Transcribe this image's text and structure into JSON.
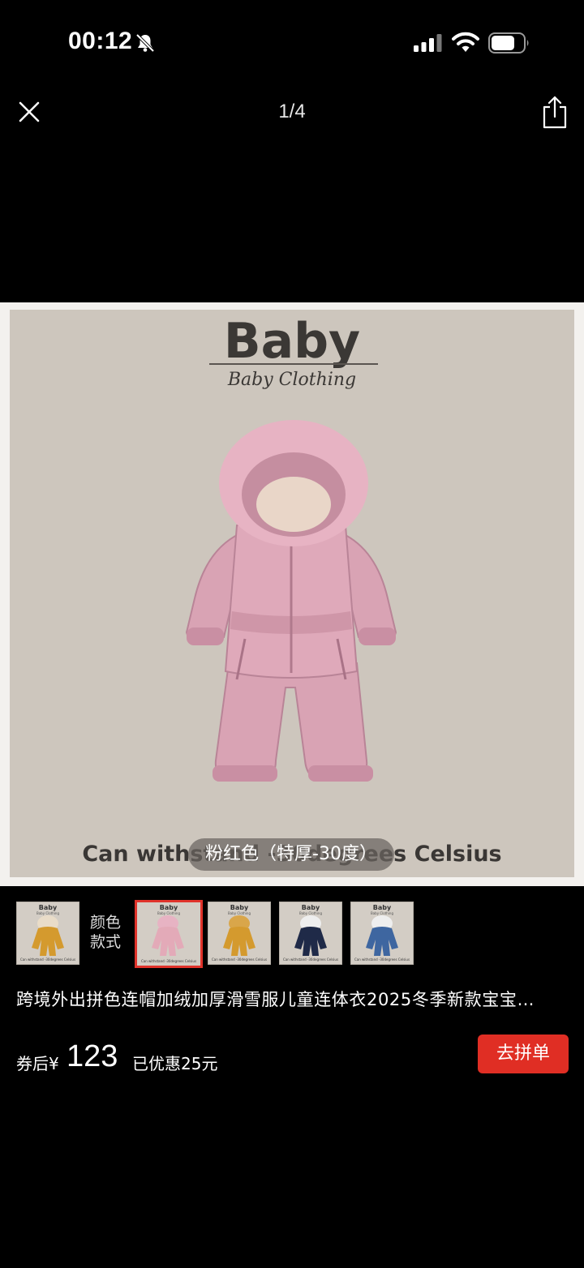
{
  "status_bar": {
    "time": "00:12",
    "icons": [
      "bell-slash-icon",
      "signal-icon",
      "wifi-icon",
      "battery-icon"
    ]
  },
  "nav": {
    "page_indicator": "1/4",
    "close_icon": "close-icon",
    "share_icon": "share-icon"
  },
  "image": {
    "title": "Baby",
    "subtitle": "Baby Clothing",
    "caption": "Can withstand -30degrees Celsius",
    "variant_label": "粉红色（特厚-30度）"
  },
  "thumbnails": {
    "label_line1": "颜色",
    "label_line2": "款式",
    "thumb_title": "Baby",
    "thumb_sub": "Baby Clothing",
    "thumb_caption": "Can withstand -30degrees Celsius",
    "items": [
      {
        "color": "#d49a2e",
        "selected": false
      },
      {
        "color": "#e3aab8",
        "selected": true
      },
      {
        "color": "#d49a2e",
        "selected": false
      },
      {
        "color": "#1f2a48",
        "selected": false
      },
      {
        "color": "#3e66a0",
        "selected": false
      }
    ]
  },
  "product": {
    "title": "跨境外出拼色连帽加绒加厚滑雪服儿童连体衣2025冬季新款宝宝…",
    "price_prefix": "券后¥",
    "price": "123",
    "discount": "已优惠25元",
    "buy_label": "去拼单"
  },
  "colors": {
    "accent": "#e02e24",
    "background": "#000000"
  }
}
